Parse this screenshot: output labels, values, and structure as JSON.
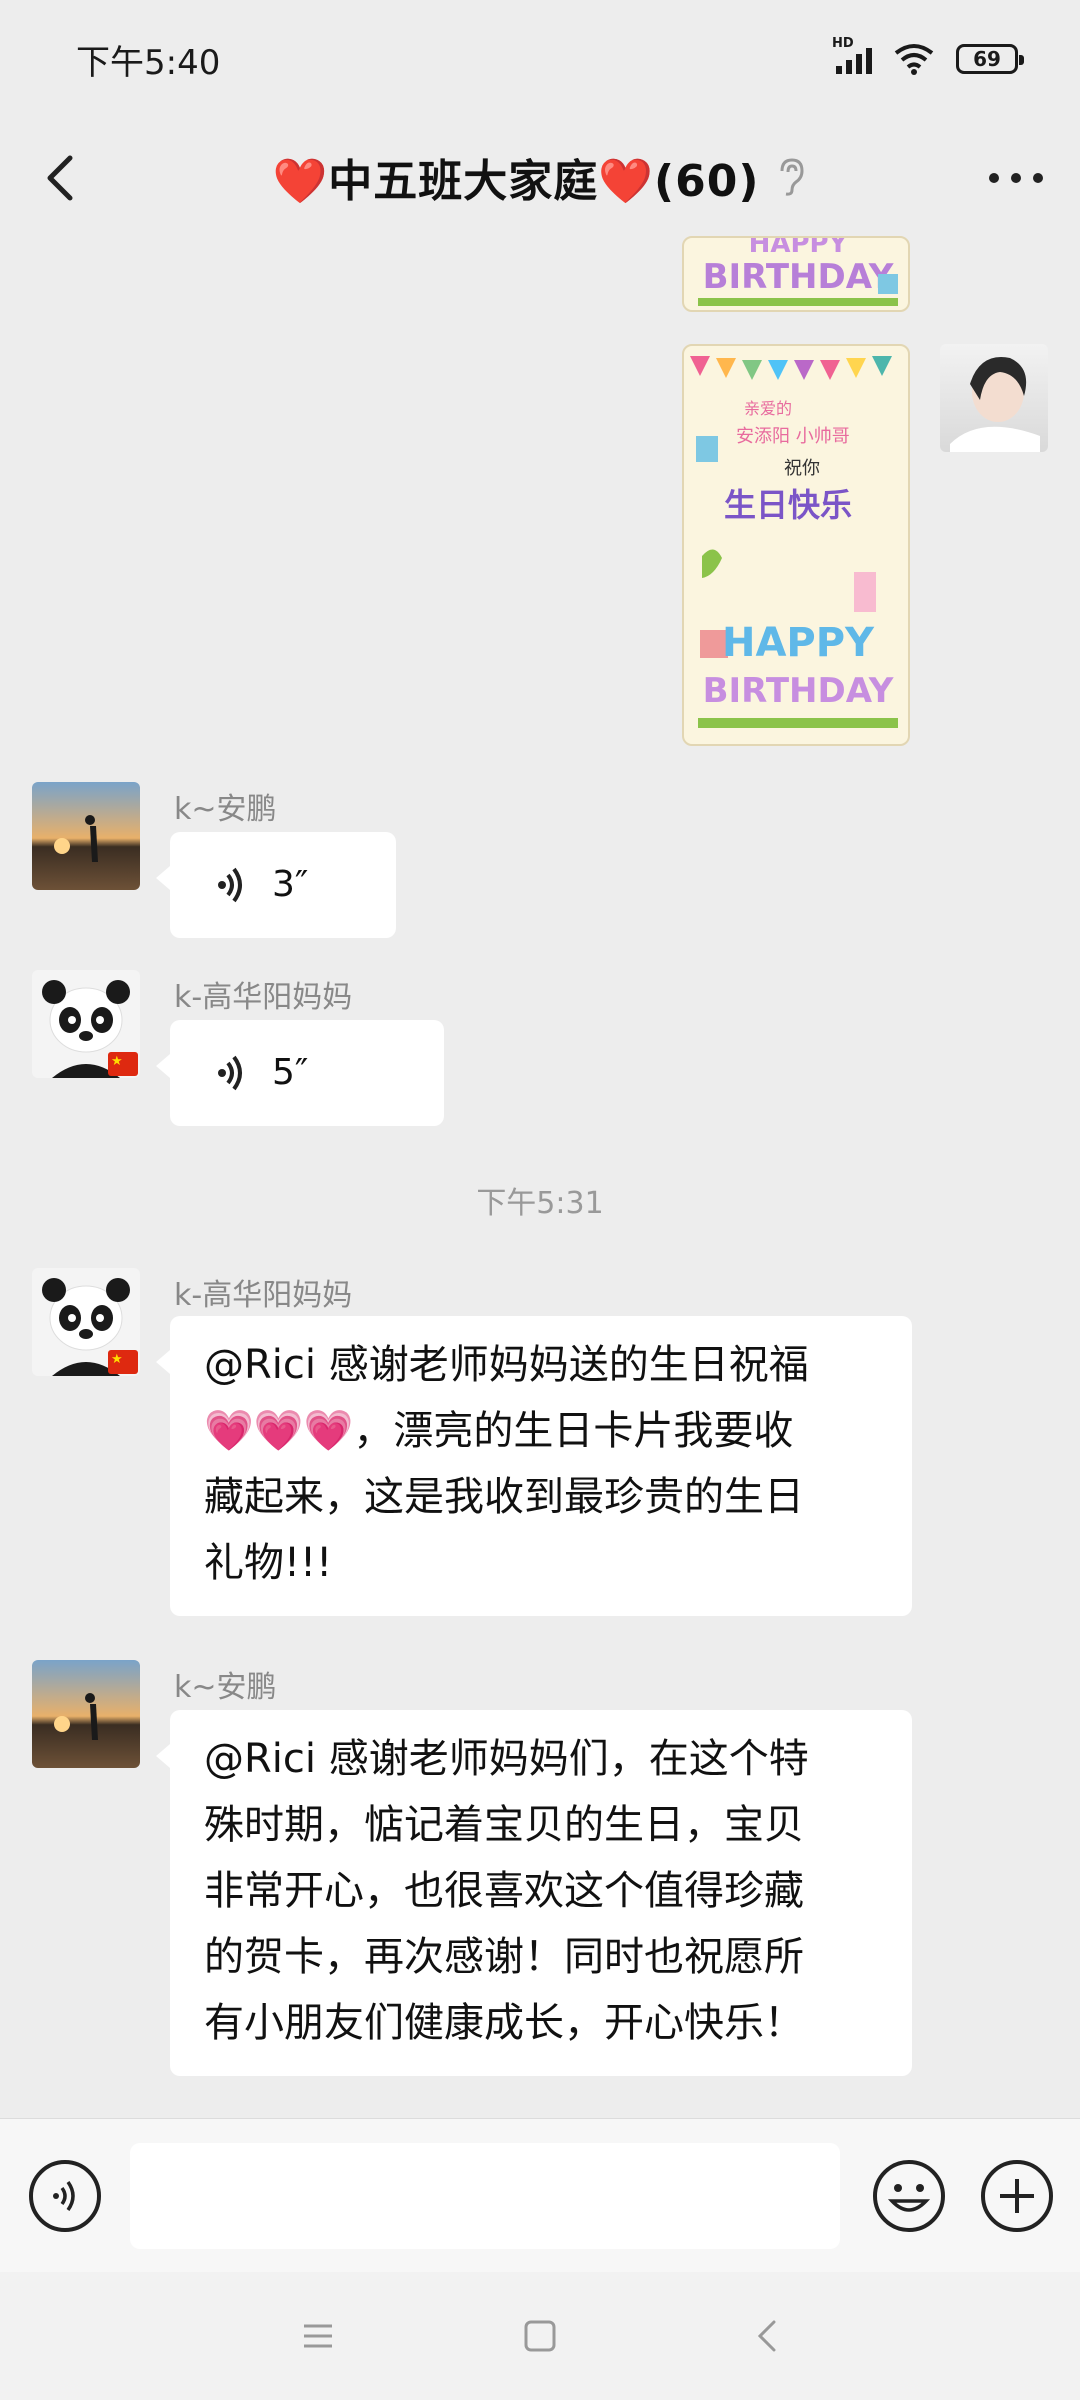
{
  "status_bar": {
    "time": "下午5:40",
    "network": "HD",
    "battery": "69"
  },
  "header": {
    "title": "❤️中五班大家庭❤️(60)"
  },
  "messages": [
    {
      "sender": "k~安鹏",
      "type": "voice",
      "duration": "3″"
    },
    {
      "sender": "k-高华阳妈妈",
      "type": "voice",
      "duration": "5″"
    },
    {
      "type": "time",
      "text": "下午5:31"
    },
    {
      "sender": "k-高华阳妈妈",
      "type": "text",
      "text": "@Rici 感谢老师妈妈送的生日祝福\n💗💗💗，漂亮的生日卡片我要收\n藏起来，这是我收到最珍贵的生日\n礼物!!!"
    },
    {
      "sender": "k~安鹏",
      "type": "text",
      "text": "@Rici 感谢老师妈妈们，在这个特\n殊时期，惦记着宝贝的生日，宝贝\n非常开心，也很喜欢这个值得珍藏\n的贺卡，再次感谢！同时也祝愿所\n有小朋友们健康成长，开心快乐！"
    }
  ],
  "cards": {
    "top": {
      "line1": "HAPPY",
      "line2": "BIRTHDAY"
    },
    "main": {
      "greeting": "亲爱的",
      "name": "安添阳 小帅哥",
      "wish": "祝你",
      "main": "生日快乐",
      "line1": "HAPPY",
      "line2": "BIRTHDAY"
    }
  },
  "input": {
    "placeholder": ""
  },
  "colors": {
    "background": "#ededed",
    "bubble": "#ffffff",
    "card_text": "#7b55c7"
  }
}
